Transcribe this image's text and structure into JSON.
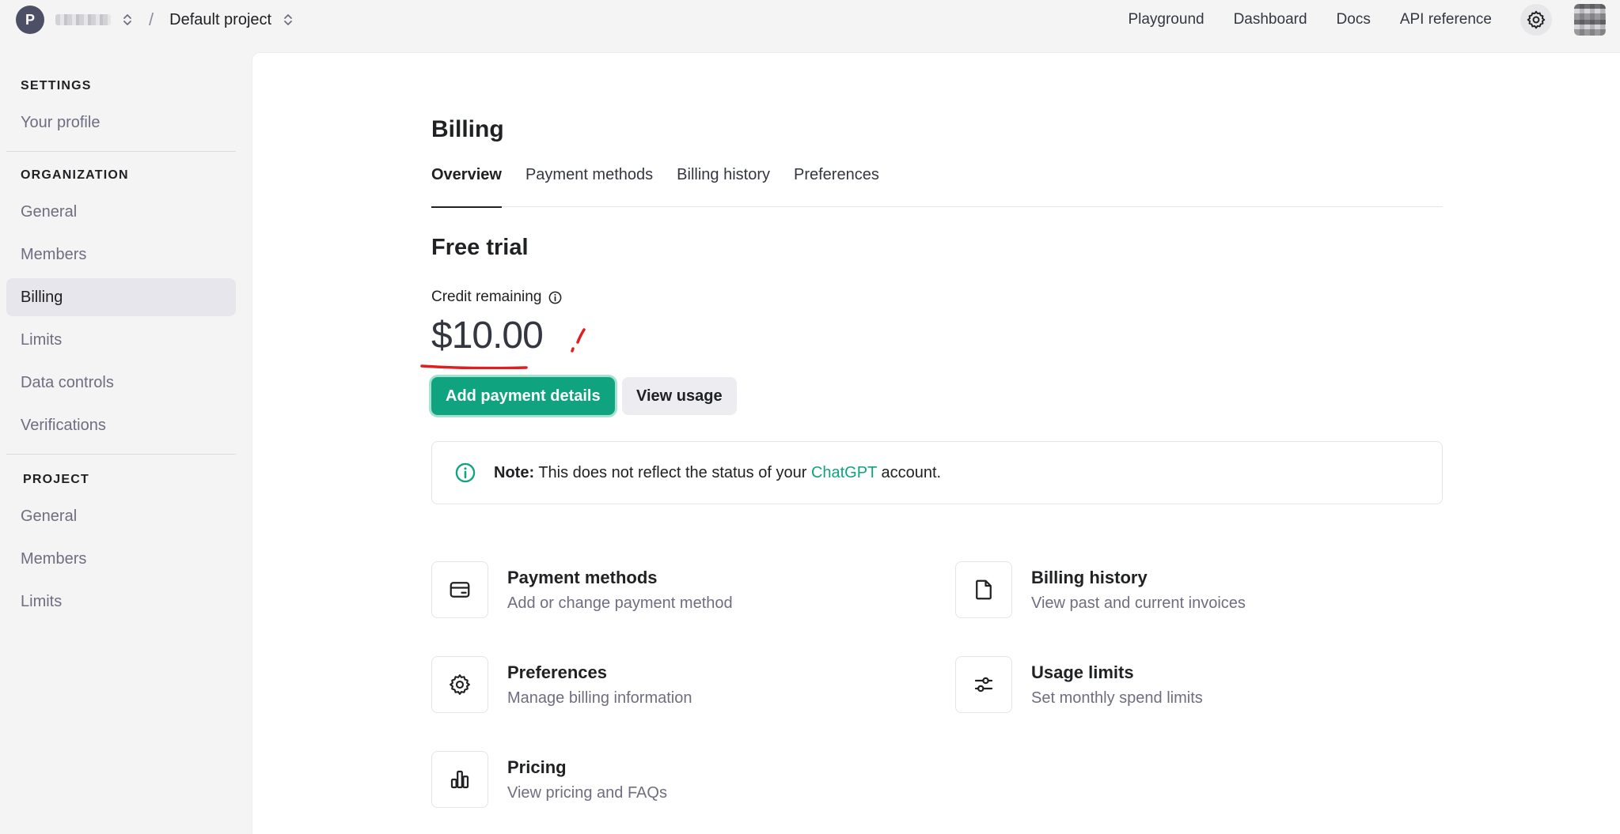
{
  "topbar": {
    "org_initial": "P",
    "project_name": "Default project",
    "separator": "/",
    "nav": [
      {
        "label": "Playground"
      },
      {
        "label": "Dashboard"
      },
      {
        "label": "Docs"
      },
      {
        "label": "API reference"
      }
    ]
  },
  "sidebar": {
    "settings_heading": "SETTINGS",
    "settings_items": [
      {
        "label": "Your profile"
      }
    ],
    "organization_heading": "ORGANIZATION",
    "organization_items": [
      {
        "label": "General"
      },
      {
        "label": "Members"
      },
      {
        "label": "Billing"
      },
      {
        "label": "Limits"
      },
      {
        "label": "Data controls"
      },
      {
        "label": "Verifications"
      }
    ],
    "project_heading": "PROJECT",
    "project_items": [
      {
        "label": "General"
      },
      {
        "label": "Members"
      },
      {
        "label": "Limits"
      }
    ]
  },
  "main": {
    "title": "Billing",
    "tabs": [
      {
        "label": "Overview"
      },
      {
        "label": "Payment methods"
      },
      {
        "label": "Billing history"
      },
      {
        "label": "Preferences"
      }
    ],
    "section_title": "Free trial",
    "credit_label": "Credit remaining",
    "credit_value": "$10.00",
    "primary_button": "Add payment details",
    "secondary_button": "View usage",
    "note": {
      "label": "Note:",
      "text_before": "This does not reflect the status of your",
      "link": "ChatGPT",
      "text_after": "account."
    },
    "cards": [
      {
        "title": "Payment methods",
        "desc": "Add or change payment method",
        "icon": "credit-card-icon"
      },
      {
        "title": "Billing history",
        "desc": "View past and current invoices",
        "icon": "document-icon"
      },
      {
        "title": "Preferences",
        "desc": "Manage billing information",
        "icon": "gear-icon"
      },
      {
        "title": "Usage limits",
        "desc": "Set monthly spend limits",
        "icon": "sliders-icon"
      },
      {
        "title": "Pricing",
        "desc": "View pricing and FAQs",
        "icon": "bar-chart-icon"
      }
    ]
  },
  "colors": {
    "accent": "#10a37f",
    "annotation": "#e11d1d"
  }
}
